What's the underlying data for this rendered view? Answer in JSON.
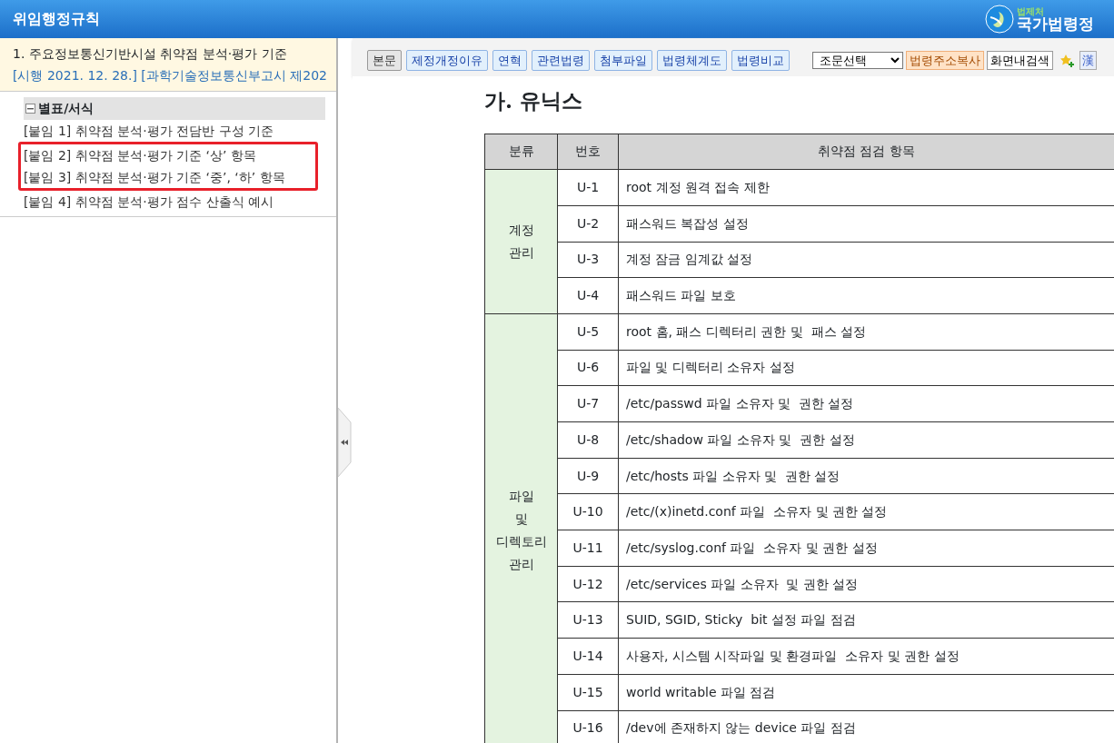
{
  "header": {
    "title": "위임행정규칙",
    "logo_small": "법제처",
    "logo_big": "국가법령정"
  },
  "sidebar": {
    "law_title": "1.  주요정보통신기반시설 취약점 분석·평가 기준",
    "law_meta": "[시행 2021. 12. 28.] [과학기술정보통신부고시 제202",
    "tree": [
      {
        "label": "별표/서식",
        "expanded": true,
        "children": [
          {
            "label": "[붙임 1] 취약점 분석·평가 전담반 구성 기준",
            "highlighted": false
          },
          {
            "label": "[붙임 2] 취약점 분석·평가 기준 ‘상’ 항목",
            "highlighted": true
          },
          {
            "label": "[붙임 3] 취약점 분석·평가 기준 ‘중’, ‘하’ 항목",
            "highlighted": true
          },
          {
            "label": "[붙임 4] 취약점 분석·평가 점수 산출식 예시",
            "highlighted": false
          }
        ]
      }
    ]
  },
  "toolbar": {
    "tabs": [
      {
        "label": "본문",
        "selected": true
      },
      {
        "label": "제정개정이유",
        "selected": false
      },
      {
        "label": "연혁",
        "selected": false
      },
      {
        "label": "관련법령",
        "selected": false
      },
      {
        "label": "첨부파일",
        "selected": false
      },
      {
        "label": "법령체계도",
        "selected": false
      },
      {
        "label": "법령비교",
        "selected": false
      }
    ],
    "select": {
      "value": "조문선택"
    },
    "copy_button": "법령주소복사",
    "search_button": "화면내검색",
    "hanja_button": "漢"
  },
  "document": {
    "heading": "가. 유닉스",
    "columns": [
      "분류",
      "번호",
      "취약점 점검 항목"
    ],
    "groups": [
      {
        "category": "계정\n관리",
        "rows": [
          [
            "U-1",
            "root 계정 원격 접속 제한"
          ],
          [
            "U-2",
            "패스워드 복잡성 설정"
          ],
          [
            "U-3",
            "계정 잠금 임계값 설정"
          ],
          [
            "U-4",
            "패스워드 파일 보호"
          ]
        ]
      },
      {
        "category": "파일\n및\n디렉토리\n관리",
        "rows": [
          [
            "U-5",
            "root 홈, 패스 디렉터리 권한 및  패스 설정"
          ],
          [
            "U-6",
            "파일 및 디렉터리 소유자 설정"
          ],
          [
            "U-7",
            "/etc/passwd 파일 소유자 및  권한 설정"
          ],
          [
            "U-8",
            "/etc/shadow 파일 소유자 및  권한 설정"
          ],
          [
            "U-9",
            "/etc/hosts 파일 소유자 및  권한 설정"
          ],
          [
            "U-10",
            "/etc/(x)inetd.conf 파일  소유자 및 권한 설정"
          ],
          [
            "U-11",
            "/etc/syslog.conf 파일  소유자 및 권한 설정"
          ],
          [
            "U-12",
            "/etc/services 파일 소유자  및 권한 설정"
          ],
          [
            "U-13",
            "SUID, SGID, Sticky  bit 설정 파일 점검"
          ],
          [
            "U-14",
            "사용자, 시스템 시작파일 및 환경파일  소유자 및 권한 설정"
          ],
          [
            "U-15",
            "world writable 파일 점검"
          ],
          [
            "U-16",
            "/dev에 존재하지 않는 device 파일 점검"
          ]
        ]
      }
    ]
  }
}
